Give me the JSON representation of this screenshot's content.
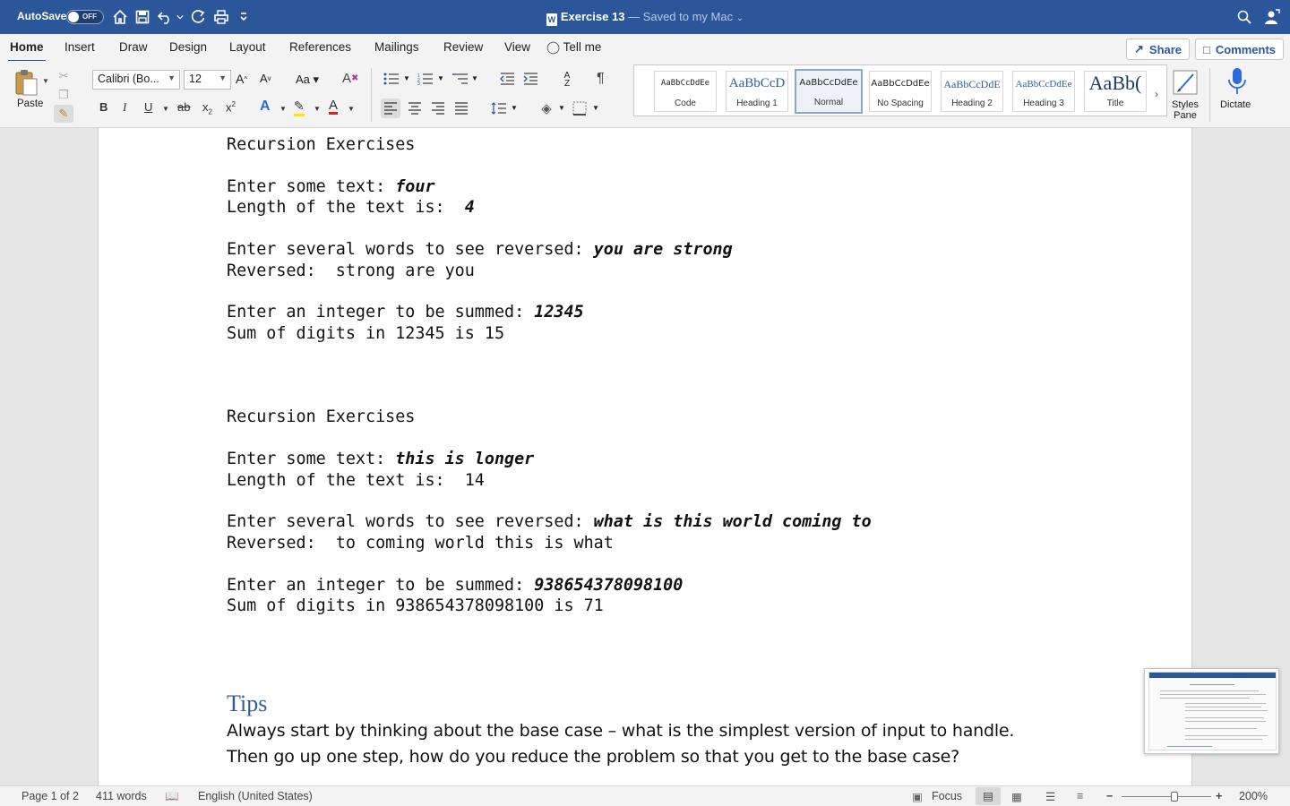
{
  "titlebar": {
    "autosave_label": "AutoSave",
    "autosave_state": "OFF",
    "doc_title": "Exercise 13",
    "saved_status": "— Saved to my Mac"
  },
  "tabs": [
    "Home",
    "Insert",
    "Draw",
    "Design",
    "Layout",
    "References",
    "Mailings",
    "Review",
    "View",
    "Tell me"
  ],
  "actions": {
    "share": "Share",
    "comments": "Comments"
  },
  "ribbon": {
    "paste": "Paste",
    "font_name": "Calibri (Bo...",
    "font_size": "12",
    "styles": [
      {
        "sample": "AaBbCcDdEe",
        "name": "Code"
      },
      {
        "sample": "AaBbCcD",
        "name": "Heading 1"
      },
      {
        "sample": "AaBbCcDdEe",
        "name": "Normal"
      },
      {
        "sample": "AaBbCcDdEe",
        "name": "No Spacing"
      },
      {
        "sample": "AaBbCcDdE",
        "name": "Heading 2"
      },
      {
        "sample": "AaBbCcDdEe",
        "name": "Heading 3"
      },
      {
        "sample": "AaBb(",
        "name": "Title"
      }
    ],
    "styles_pane_1": "Styles",
    "styles_pane_2": "Pane",
    "dictate": "Dictate"
  },
  "document": {
    "block1": {
      "heading": "Recursion Exercises",
      "l1_prompt": "Enter some text: ",
      "l1_input": "four",
      "l2_prompt": "Length of the text is:  ",
      "l2_value": "4",
      "l3_prompt": "Enter several words to see reversed: ",
      "l3_input": "you are strong",
      "l4": "Reversed:  strong are you",
      "l5_prompt": "Enter an integer to be summed: ",
      "l5_input": "12345",
      "l6": "Sum of digits in 12345 is 15"
    },
    "block2": {
      "heading": "Recursion Exercises",
      "l1_prompt": "Enter some text: ",
      "l1_input": "this is longer",
      "l2": "Length of the text is:  14",
      "l3_prompt": "Enter several words to see reversed: ",
      "l3_input": "what is this world coming to",
      "l4": "Reversed:  to coming world this is what",
      "l5_prompt": "Enter an integer to be summed: ",
      "l5_input": "938654378098100",
      "l6": "Sum of digits in 938654378098100 is 71"
    },
    "tips_title": "Tips",
    "tips_line1": "Always start by thinking about the base case – what is the simplest version of input to handle.",
    "tips_line2": "Then go up one step, how do you reduce the problem so that you get to the base case?"
  },
  "status": {
    "page": "Page 1 of 2",
    "words": "411 words",
    "language": "English (United States)",
    "focus": "Focus",
    "zoom": "200%"
  },
  "colors": {
    "titlebar": "#2b579a",
    "heading_blue": "#2e5c9b"
  }
}
